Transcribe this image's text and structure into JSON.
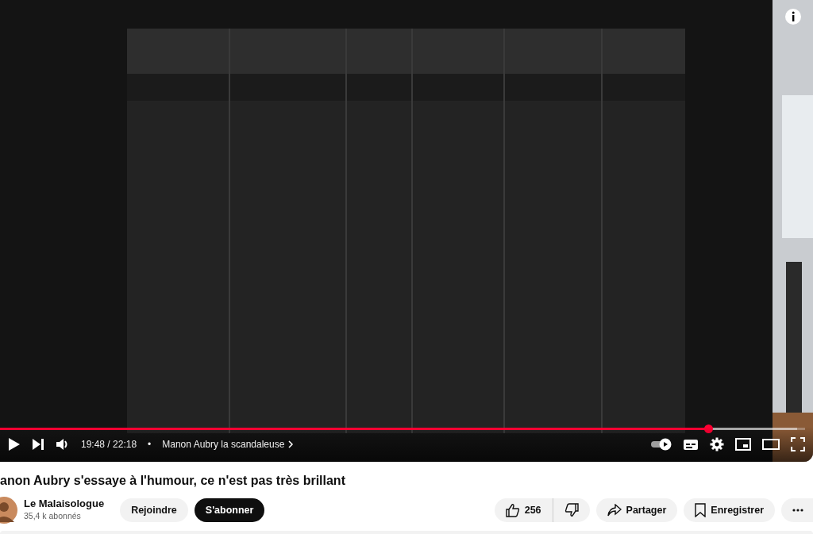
{
  "player": {
    "time": "19:48 / 22:18",
    "separator": "•",
    "chapter": "Manon Aubry la scandaleuse",
    "progress": {
      "level": 0.88
    },
    "autoplay": {
      "on": true
    }
  },
  "video": {
    "title": "anon Aubry s'essaye à l'humour, ce n'est pas très brillant"
  },
  "channel": {
    "name": "Le Malaisologue",
    "subscribers": "35,4 k abonnés",
    "join": "Rejoindre",
    "subscribe": "S'abonner"
  },
  "actions": {
    "likes": "256",
    "share": "Partager",
    "save": "Enregistrer"
  }
}
